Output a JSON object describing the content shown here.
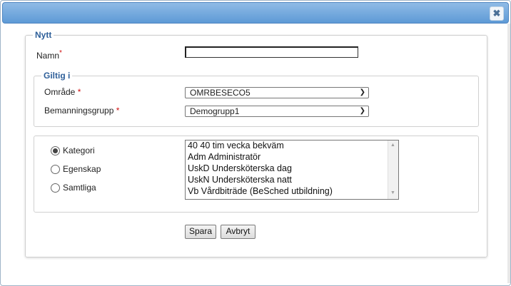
{
  "dialog": {
    "close_glyph": "✖"
  },
  "form": {
    "legend": "Nytt",
    "name_label": "Namn",
    "required_mark": "*",
    "name_value": ""
  },
  "validity": {
    "legend": "Giltig i",
    "area_label": "Område",
    "area_value": "OMRBESECO5",
    "staffing_label": "Bemanningsgrupp",
    "staffing_value": "Demogrupp1"
  },
  "filter": {
    "options": [
      {
        "label": "Kategori",
        "checked": true
      },
      {
        "label": "Egenskap",
        "checked": false
      },
      {
        "label": "Samtliga",
        "checked": false
      }
    ],
    "list_items": [
      "40 40 tim vecka bekväm",
      "Adm Administratör",
      "UskD Undersköterska dag",
      "UskN Undersköterska natt",
      "Vb Vårdbiträde (BeSched utbildning)"
    ]
  },
  "buttons": {
    "save": "Spara",
    "cancel": "Avbryt"
  },
  "icons": {
    "close": "close-icon",
    "dropdown": "chevron-down-icon",
    "scroll_up": "arrow-up-icon",
    "scroll_down": "arrow-down-icon"
  }
}
